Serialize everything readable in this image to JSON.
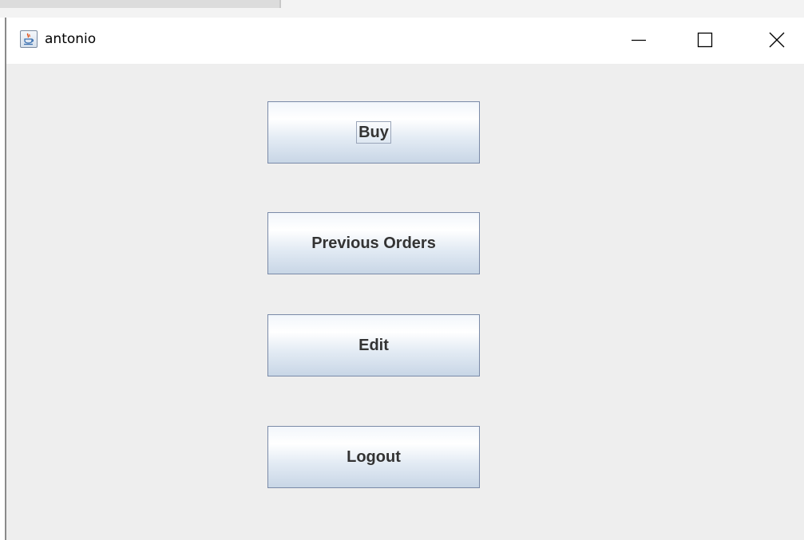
{
  "window": {
    "title": "antonio",
    "icon": "java-coffee-cup-icon"
  },
  "titlebar_controls": {
    "minimize_icon": "minimize-icon",
    "maximize_icon": "maximize-icon",
    "close_icon": "close-icon"
  },
  "menu": {
    "buy_label": "Buy",
    "previous_orders_label": "Previous Orders",
    "edit_label": "Edit",
    "logout_label": "Logout",
    "focused_button": "Buy"
  },
  "colors": {
    "content_background": "#eeeeee",
    "titlebar_background": "#ffffff",
    "button_border": "#7a8aa8",
    "button_gradient_bottom": "#c8d6e6",
    "button_text": "#333333"
  }
}
